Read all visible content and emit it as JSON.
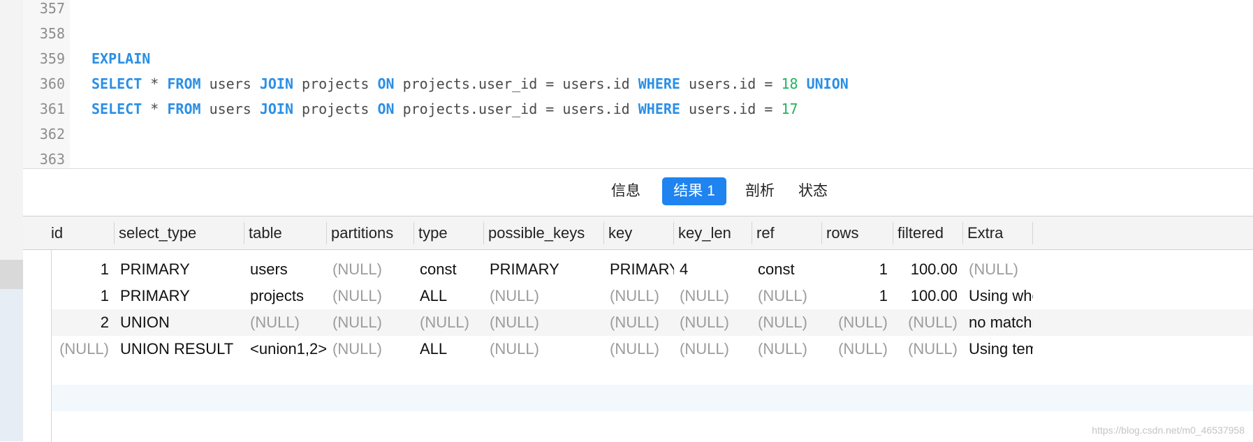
{
  "editor": {
    "lines": [
      {
        "num": "357",
        "tokens": []
      },
      {
        "num": "358",
        "tokens": []
      },
      {
        "num": "359",
        "tokens": [
          {
            "t": "EXPLAIN",
            "k": "kw"
          }
        ]
      },
      {
        "num": "360",
        "tokens": [
          {
            "t": "SELECT",
            "k": "kw"
          },
          {
            "t": " * ",
            "k": ""
          },
          {
            "t": "FROM",
            "k": "kw"
          },
          {
            "t": " users ",
            "k": ""
          },
          {
            "t": "JOIN",
            "k": "kw"
          },
          {
            "t": " projects ",
            "k": ""
          },
          {
            "t": "ON",
            "k": "kw"
          },
          {
            "t": " projects.user_id = users.id ",
            "k": ""
          },
          {
            "t": "WHERE",
            "k": "kw"
          },
          {
            "t": " users.id = ",
            "k": ""
          },
          {
            "t": "18",
            "k": "num"
          },
          {
            "t": " ",
            "k": ""
          },
          {
            "t": "UNION",
            "k": "kw"
          }
        ]
      },
      {
        "num": "361",
        "tokens": [
          {
            "t": "SELECT",
            "k": "kw"
          },
          {
            "t": " * ",
            "k": ""
          },
          {
            "t": "FROM",
            "k": "kw"
          },
          {
            "t": " users ",
            "k": ""
          },
          {
            "t": "JOIN",
            "k": "kw"
          },
          {
            "t": " projects ",
            "k": ""
          },
          {
            "t": "ON",
            "k": "kw"
          },
          {
            "t": " projects.user_id = users.id ",
            "k": ""
          },
          {
            "t": "WHERE",
            "k": "kw"
          },
          {
            "t": " users.id = ",
            "k": ""
          },
          {
            "t": "17",
            "k": "num"
          }
        ]
      },
      {
        "num": "362",
        "tokens": []
      },
      {
        "num": "363",
        "tokens": []
      }
    ]
  },
  "tabs": [
    {
      "label": "信息",
      "active": false
    },
    {
      "label": "结果 1",
      "active": true
    },
    {
      "label": "剖析",
      "active": false
    },
    {
      "label": "状态",
      "active": false
    }
  ],
  "grid": {
    "columns": [
      "id",
      "select_type",
      "table",
      "partitions",
      "type",
      "possible_keys",
      "key",
      "key_len",
      "ref",
      "rows",
      "filtered",
      "Extra"
    ],
    "rows": [
      [
        "1",
        "PRIMARY",
        "users",
        "(NULL)",
        "const",
        "PRIMARY",
        "PRIMARY",
        "4",
        "const",
        "1",
        "100.00",
        "(NULL)"
      ],
      [
        "1",
        "PRIMARY",
        "projects",
        "(NULL)",
        "ALL",
        "(NULL)",
        "(NULL)",
        "(NULL)",
        "(NULL)",
        "1",
        "100.00",
        "Using whe"
      ],
      [
        "2",
        "UNION",
        "(NULL)",
        "(NULL)",
        "(NULL)",
        "(NULL)",
        "(NULL)",
        "(NULL)",
        "(NULL)",
        "(NULL)",
        "(NULL)",
        "no matchi"
      ],
      [
        "(NULL)",
        "UNION RESULT",
        "<union1,2>",
        "(NULL)",
        "ALL",
        "(NULL)",
        "(NULL)",
        "(NULL)",
        "(NULL)",
        "(NULL)",
        "(NULL)",
        "Using tem"
      ]
    ]
  },
  "watermark": "https://blog.csdn.net/m0_46537958",
  "colors": {
    "accent": "#1f83f0",
    "keyword": "#2a8fe6",
    "number": "#22b35c",
    "null_text": "#9c9c9c"
  }
}
